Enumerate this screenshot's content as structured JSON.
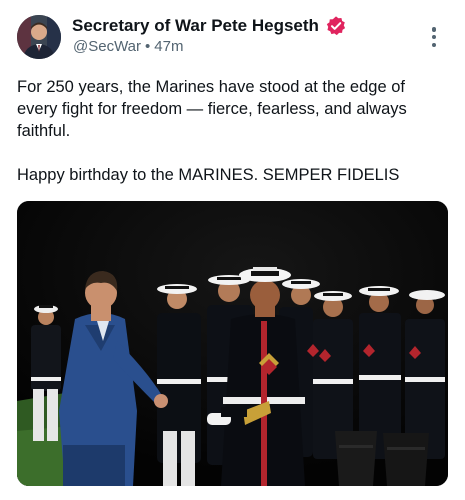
{
  "author": {
    "display_name": "Secretary of War Pete Hegseth",
    "handle": "@SecWar",
    "separator": "•",
    "timestamp": "47m",
    "verified": true,
    "verified_badge_color": "#e0245e",
    "avatar_icon": "profile-photo"
  },
  "more_menu_icon": "vertical-ellipsis-icon",
  "post": {
    "paragraphs": [
      "For 250 years, the Marines have stood at the edge of every fight for freedom — fierce, fearless, and always faithful.",
      "Happy birthday to the MARINES. SEMPER FIDELIS"
    ]
  },
  "media": {
    "kind": "photo",
    "dominant_colors": {
      "night_sky": "#050505",
      "suit": "#2a4f8e",
      "dress_blues": "#101318",
      "white_cover": "#f2f2f2",
      "red_trim": "#b3252d",
      "grass": "#2f5a22"
    }
  }
}
